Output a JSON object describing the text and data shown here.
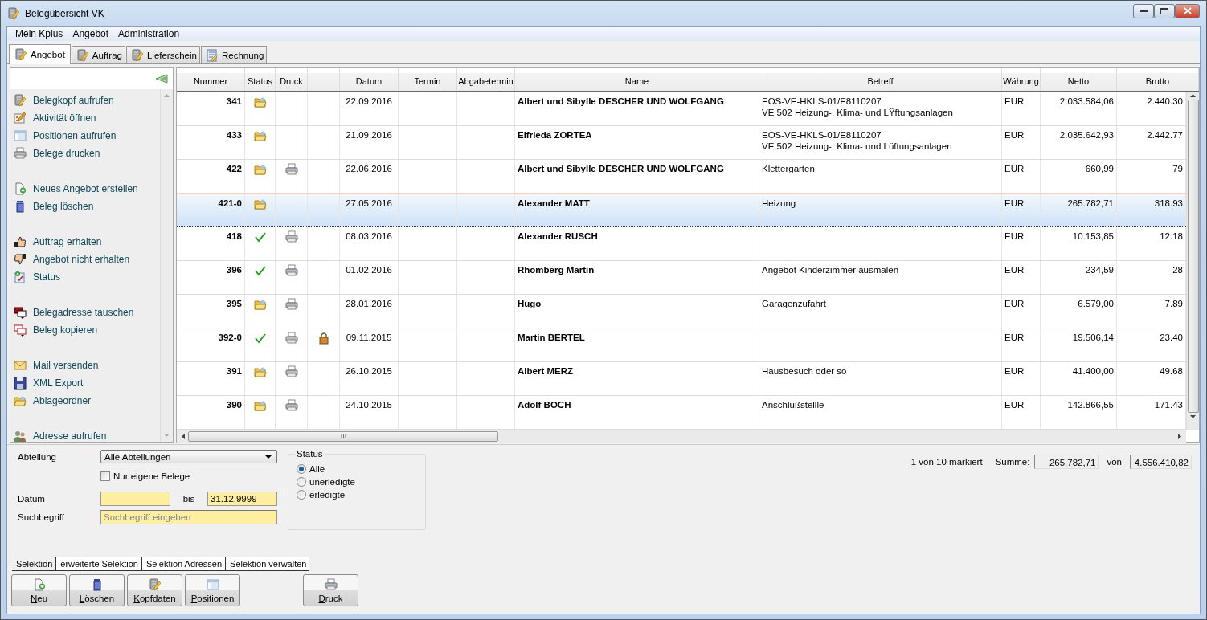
{
  "window": {
    "title": "Belegübersicht VK"
  },
  "menu": [
    "Mein Kplus",
    "Angebot",
    "Administration"
  ],
  "tabs": [
    {
      "label": "Angebot",
      "selected": true
    },
    {
      "label": "Auftrag",
      "selected": false
    },
    {
      "label": "Lieferschein",
      "selected": false
    },
    {
      "label": "Rechnung",
      "selected": false
    }
  ],
  "sidebar": {
    "groups": [
      [
        {
          "label": "Belegkopf aufrufen"
        },
        {
          "label": "Aktivität öffnen"
        },
        {
          "label": "Positionen aufrufen"
        },
        {
          "label": "Belege drucken"
        }
      ],
      [
        {
          "label": "Neues Angebot erstellen"
        },
        {
          "label": "Beleg löschen"
        }
      ],
      [
        {
          "label": "Auftrag erhalten"
        },
        {
          "label": "Angebot nicht erhalten"
        },
        {
          "label": "Status"
        }
      ],
      [
        {
          "label": "Belegadresse tauschen"
        },
        {
          "label": "Beleg kopieren"
        }
      ],
      [
        {
          "label": "Mail versenden"
        },
        {
          "label": "XML Export"
        },
        {
          "label": "Ablageordner"
        }
      ],
      [
        {
          "label": "Adresse aufrufen"
        }
      ]
    ]
  },
  "table": {
    "columns": [
      {
        "label": "Nummer",
        "kind": "number"
      },
      {
        "label": "Status",
        "kind": "status"
      },
      {
        "label": "Druck",
        "kind": "print"
      },
      {
        "kind": "lock"
      },
      {
        "label": "Datum",
        "kind": "center"
      },
      {
        "label": "Termin",
        "kind": "center"
      },
      {
        "label": "Abgabetermin",
        "kind": "center"
      },
      {
        "label": "Name",
        "kind": "bold"
      },
      {
        "label": "Betreff",
        "kind": "text"
      },
      {
        "label": "Währung",
        "kind": "text"
      },
      {
        "label": "Netto",
        "kind": "money"
      },
      {
        "label": "Brutto",
        "kind": "money"
      }
    ],
    "rows": [
      {
        "nummer": "341",
        "done": false,
        "printed": false,
        "locked": false,
        "datum": "22.09.2016",
        "name": "Albert und Sibylle DESCHER UND WOLFGANG",
        "betreff": "EOS-VE-HKLS-01/E8110207\nVE 502 Heizung-, Klima- und LŸftungsanlagen",
        "waehrung": "EUR",
        "netto": "2.033.584,06",
        "brutto": "2.440.30",
        "selected": false
      },
      {
        "nummer": "433",
        "done": false,
        "printed": false,
        "locked": false,
        "datum": "21.09.2016",
        "name": "Elfrieda ZORTEA",
        "betreff": "EOS-VE-HKLS-01/E8110207\nVE 502 Heizung-, Klima- und Lüftungsanlagen",
        "waehrung": "EUR",
        "netto": "2.035.642,93",
        "brutto": "2.442.77",
        "selected": false
      },
      {
        "nummer": "422",
        "done": false,
        "printed": true,
        "locked": false,
        "datum": "22.06.2016",
        "name": "Albert und Sibylle DESCHER UND WOLFGANG",
        "betreff": "Klettergarten",
        "waehrung": "EUR",
        "netto": "660,99",
        "brutto": "79",
        "selected": false
      },
      {
        "nummer": "421-0",
        "done": false,
        "printed": false,
        "locked": false,
        "datum": "27.05.2016",
        "name": "Alexander MATT",
        "betreff": "Heizung",
        "waehrung": "EUR",
        "netto": "265.782,71",
        "brutto": "318.93",
        "selected": true
      },
      {
        "nummer": "418",
        "done": true,
        "printed": true,
        "locked": false,
        "datum": "08.03.2016",
        "name": "Alexander RUSCH",
        "waehrung": "EUR",
        "netto": "10.153,85",
        "brutto": "12.18",
        "selected": false
      },
      {
        "nummer": "396",
        "done": true,
        "printed": true,
        "locked": false,
        "datum": "01.02.2016",
        "name": "Rhomberg Martin",
        "betreff": "Angebot Kinderzimmer ausmalen",
        "waehrung": "EUR",
        "netto": "234,59",
        "brutto": "28",
        "selected": false
      },
      {
        "nummer": "395",
        "done": false,
        "printed": true,
        "locked": false,
        "datum": "28.01.2016",
        "name": "Hugo",
        "betreff": "Garagenzufahrt",
        "waehrung": "EUR",
        "netto": "6.579,00",
        "brutto": "7.89",
        "selected": false
      },
      {
        "nummer": "392-0",
        "done": true,
        "printed": true,
        "locked": true,
        "datum": "09.11.2015",
        "name": "Martin BERTEL",
        "waehrung": "EUR",
        "netto": "19.506,14",
        "brutto": "23.40",
        "selected": false
      },
      {
        "nummer": "391",
        "done": false,
        "printed": true,
        "locked": false,
        "datum": "26.10.2015",
        "name": "Albert MERZ",
        "betreff": "Hausbesuch oder so",
        "waehrung": "EUR",
        "netto": "41.400,00",
        "brutto": "49.68",
        "selected": false
      },
      {
        "nummer": "390",
        "done": false,
        "printed": true,
        "locked": false,
        "datum": "24.10.2015",
        "name": "Adolf BOCH",
        "betreff": "Anschlußstellle",
        "waehrung": "EUR",
        "netto": "142.866,55",
        "brutto": "171.43",
        "selected": false
      }
    ]
  },
  "filter": {
    "abteilung": {
      "label": "Abteilung",
      "value": "Alle Abteilungen"
    },
    "own_only": {
      "label": "Nur eigene Belege",
      "checked": false
    },
    "datum": {
      "label": "Datum",
      "to_label": "bis",
      "to_value": "31.12.9999"
    },
    "suchbegriff": {
      "label": "Suchbegriff",
      "placeholder": "Suchbegriff eingeben"
    },
    "status": {
      "title": "Status",
      "options": [
        {
          "label": "Alle",
          "selected": true
        },
        {
          "label": "unerledigte",
          "selected": false
        },
        {
          "label": "erledigte",
          "selected": false
        }
      ]
    }
  },
  "summary": {
    "marked": "1 von 10 markiert",
    "sum_label": "Summe:",
    "sum": "265.782,71",
    "of_label": "von",
    "total": "4.556.410,82"
  },
  "selection_tabs": [
    {
      "label": "Selektion",
      "selected": true
    },
    {
      "label": "erweiterte Selektion",
      "selected": false
    },
    {
      "label": "Selektion Adressen",
      "selected": false
    },
    {
      "label": "Selektion verwalten",
      "selected": false
    }
  ],
  "buttons": [
    {
      "label": "Neu"
    },
    {
      "label": "Löschen"
    },
    {
      "label": "Kopfdaten"
    },
    {
      "label": "Positionen"
    },
    {
      "label": "Druck"
    }
  ]
}
